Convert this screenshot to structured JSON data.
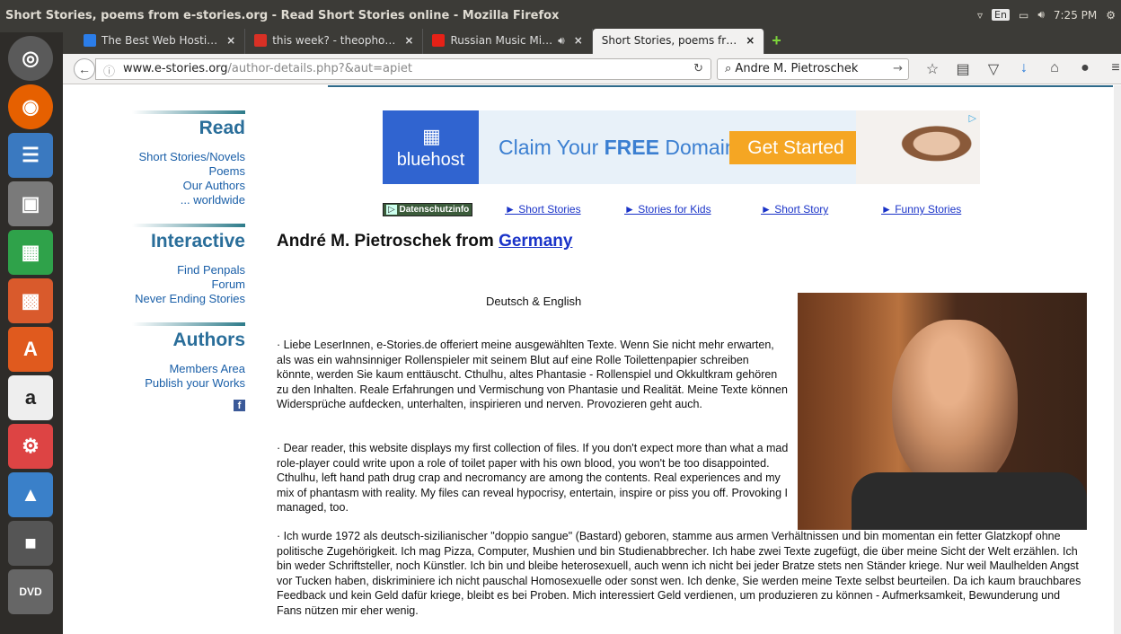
{
  "window": {
    "title": "Short Stories, poems from e-stories.org - Read Short Stories online - Mozilla Firefox"
  },
  "system": {
    "lang": "En",
    "time": "7:25 PM"
  },
  "tabs": [
    {
      "label": "The Best Web Hosti…",
      "color": "#2b7de9"
    },
    {
      "label": "this week? - theopho…",
      "color": "#d93025"
    },
    {
      "label": "Russian Music Mi…",
      "color": "#e62117"
    },
    {
      "label": "Short Stories, poems fr…",
      "color": "#f2f1f0"
    }
  ],
  "navbar": {
    "url_domain": "www.e-stories.org",
    "url_path": "/author-details.php?&aut=apiet",
    "search_value": "Andre M. Pietroschek"
  },
  "sidebar": {
    "read": {
      "title": "Read",
      "links": [
        "Short Stories/Novels",
        "Poems",
        "Our Authors",
        "... worldwide"
      ]
    },
    "interactive": {
      "title": "Interactive",
      "links": [
        "Find Penpals",
        "Forum",
        "Never Ending Stories"
      ]
    },
    "authors": {
      "title": "Authors",
      "links": [
        "Members Area",
        "Publish your Works"
      ]
    },
    "facebook_icon": "f"
  },
  "ad": {
    "brand": "bluehost",
    "text_pre": "Claim Your ",
    "text_bold": "FREE",
    "text_post": " Domain",
    "button": "Get Started"
  },
  "nav_links": {
    "privacy": "Datenschutzinfo",
    "links": [
      "► Short Stories",
      "► Stories for Kids",
      "► Short Story",
      "► Funny Stories"
    ]
  },
  "author": {
    "prefix": "André M. Pietroschek from ",
    "country": "Germany",
    "subtitle": "Deutsch & English"
  },
  "paragraphs": [
    "· Liebe LeserInnen, e-Stories.de offeriert meine ausgewählten Texte. Wenn Sie nicht mehr erwarten, als was ein wahnsinniger Rollenspieler mit seinem Blut auf eine Rolle Toilettenpapier schreiben könnte, werden Sie kaum enttäuscht. Cthulhu, altes Phantasie - Rollenspiel und Okkultkram gehören zu den Inhalten. Reale Erfahrungen und Vermischung von Phantasie und Realität. Meine Texte können Widersprüche aufdecken, unterhalten, inspirieren und nerven. Provozieren geht auch.",
    "· Dear reader, this website displays my first collection of files. If you don't expect more than what a mad role-player could write upon a role of toilet paper with his own blood, you won't be too disappointed. Cthulhu, left hand path drug crap and necromancy are among the contents. Real experiences and my mix of phantasm with reality. My files can reveal hypocrisy, entertain, inspire or piss you off. Provoking I managed, too.",
    "· Ich wurde 1972 als deutsch-sizilianischer \"doppio sangue\" (Bastard) geboren, stamme aus armen Verhältnissen und bin momentan ein fetter Glatzkopf ohne politische Zugehörigkeit. Ich mag Pizza, Computer, Mushien und bin Studienabbrecher. Ich habe zwei Texte zugefügt, die über meine Sicht der Welt erzählen. Ich bin weder Schriftsteller, noch Künstler. Ich bin und bleibe heterosexuell, auch wenn ich nicht bei jeder Bratze stets nen Ständer kriege. Nur weil Maulhelden Angst vor Tucken haben, diskriminiere ich nicht pauschal Homosexuelle oder sonst wen. Ich denke, Sie werden meine Texte selbst beurteilen. Da ich kaum brauchbares Feedback und kein Geld dafür kriege, bleibt es bei Proben. Mich interessiert Geld verdienen, um produzieren zu können - Aufmerksamkeit, Bewunderung und Fans nützen mir eher wenig."
  ]
}
